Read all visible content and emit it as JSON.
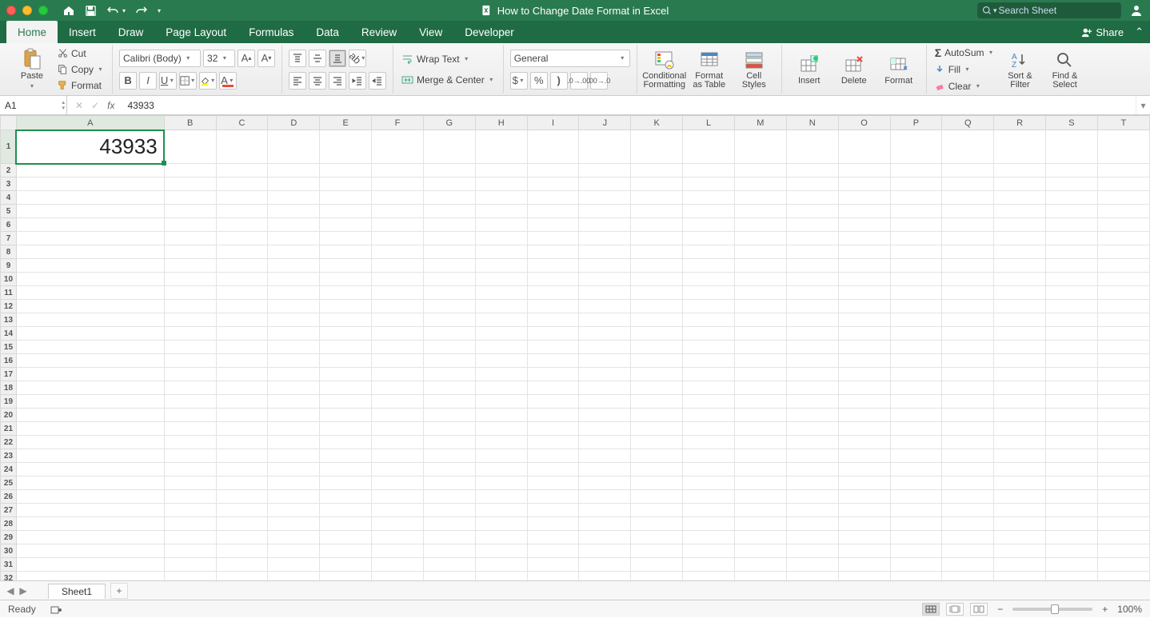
{
  "title": "How to Change Date Format in Excel",
  "search": {
    "placeholder": "Search Sheet"
  },
  "share": "Share",
  "tabs": [
    "Home",
    "Insert",
    "Draw",
    "Page Layout",
    "Formulas",
    "Data",
    "Review",
    "View",
    "Developer"
  ],
  "activeTab": "Home",
  "ribbon": {
    "paste": "Paste",
    "cut": "Cut",
    "copy": "Copy",
    "format": "Format",
    "fontName": "Calibri (Body)",
    "fontSize": "32",
    "wrap": "Wrap Text",
    "merge": "Merge & Center",
    "numFmt": "General",
    "condFmt": "Conditional\nFormatting",
    "fmtTable": "Format\nas Table",
    "cellStyles": "Cell\nStyles",
    "insert": "Insert",
    "delete": "Delete",
    "formatCells": "Format",
    "autosum": "AutoSum",
    "fill": "Fill",
    "clear": "Clear",
    "sort": "Sort &\nFilter",
    "find": "Find &\nSelect"
  },
  "nameBox": "A1",
  "formulaValue": "43933",
  "columns": [
    "A",
    "B",
    "C",
    "D",
    "E",
    "F",
    "G",
    "H",
    "I",
    "J",
    "K",
    "L",
    "M",
    "N",
    "O",
    "P",
    "Q",
    "R",
    "S",
    "T"
  ],
  "selectedCol": "A",
  "selectedRow": 1,
  "rows": 34,
  "cells": {
    "A1": "43933"
  },
  "sheetName": "Sheet1",
  "status": "Ready",
  "zoom": "100%"
}
